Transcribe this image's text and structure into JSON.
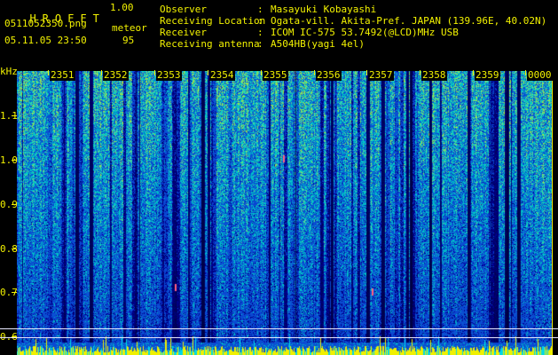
{
  "header": {
    "app_title": "HROFFT",
    "version": "1.00",
    "filename": "0511052350.png",
    "datetime": "05.11.05 23:50",
    "meteor_label": "meteor",
    "meteor_count": "95",
    "info": [
      {
        "label": "Observer",
        "value": "Masayuki Kobayashi"
      },
      {
        "label": "Receiving Location",
        "value": "Ogata-vill. Akita-Pref. JAPAN (139.96E, 40.02N)"
      },
      {
        "label": "Receiver",
        "value": "ICOM IC-575 53.7492(@LCD)MHz USB"
      },
      {
        "label": "Receiving antenna",
        "value": "A504HB(yagi 4el)"
      }
    ],
    "separator": ":"
  },
  "spectrogram": {
    "unit_label": "kHz",
    "y_ticks": [
      "1.1",
      "1.0",
      "0.9",
      "0.8",
      "0.7",
      "0.6"
    ],
    "minute_labels": [
      "2351",
      "2352",
      "2353",
      "2354",
      "2355",
      "2356",
      "2357",
      "2358",
      "2359",
      "0000"
    ],
    "colors": {
      "background": "#000000",
      "text": "#f2f200",
      "line": "#e8e8ff"
    }
  }
}
